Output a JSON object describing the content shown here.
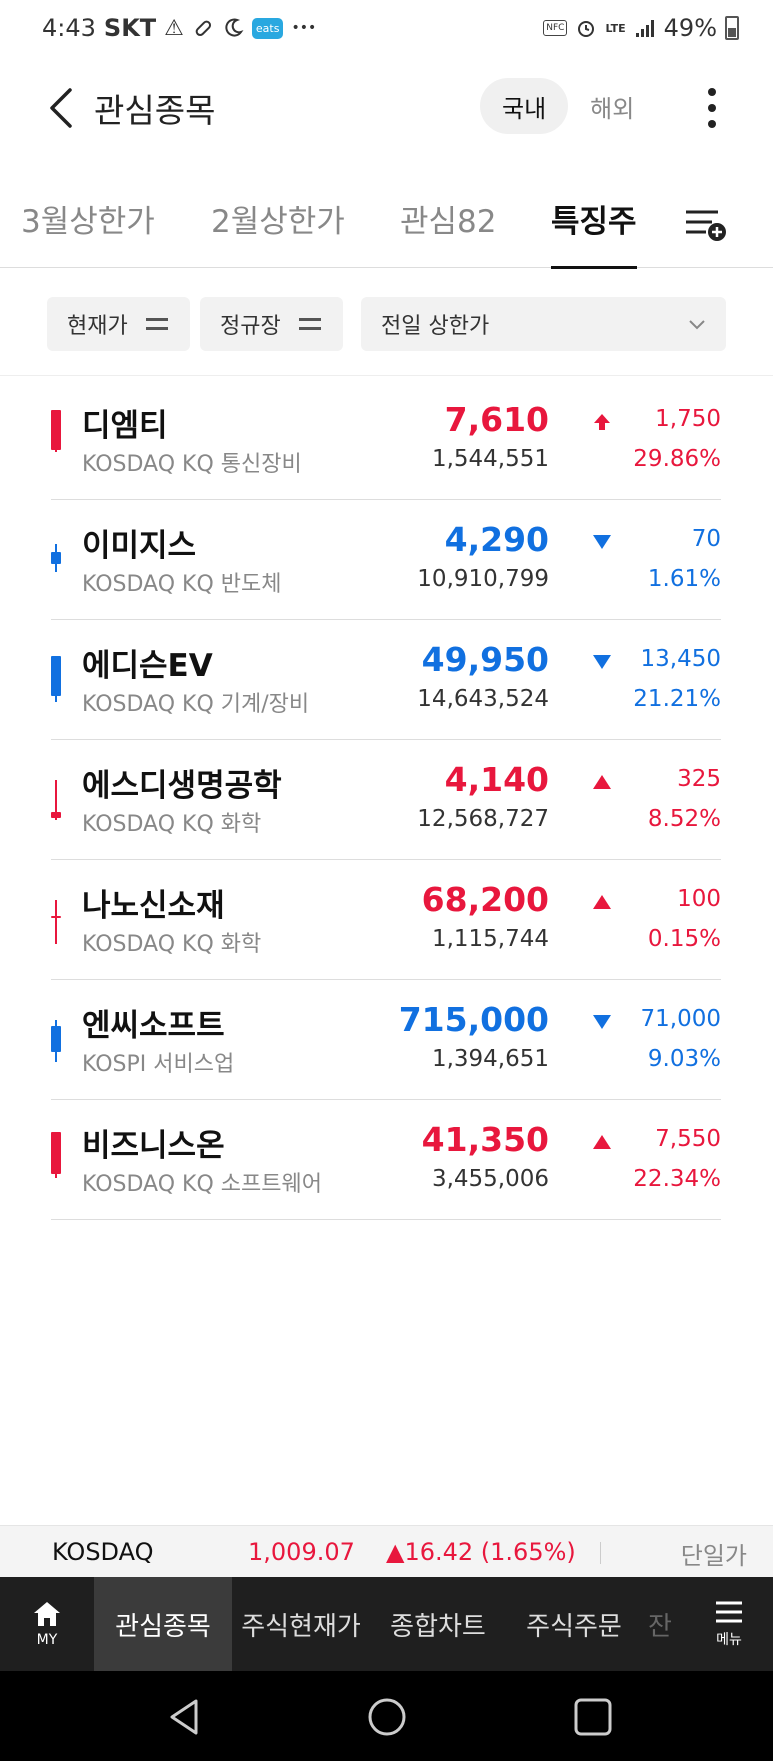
{
  "status_bar": {
    "time": "4:43",
    "carrier": "SKT",
    "eats_badge": "eats",
    "nfc_badge": "NFC",
    "network": "LTE",
    "battery": "49%",
    "icons": [
      "warning-icon",
      "pill-icon",
      "moon-icon",
      "alarm-icon",
      "signal-icon",
      "battery-icon"
    ]
  },
  "header": {
    "title": "관심종목",
    "toggle": {
      "domestic": "국내",
      "overseas": "해외",
      "selected": "국내"
    }
  },
  "tabs": {
    "items": [
      {
        "label": "3월상한가"
      },
      {
        "label": "2월상한가"
      },
      {
        "label": "관심82"
      },
      {
        "label": "특징주"
      }
    ],
    "selected": "특징주"
  },
  "filters": {
    "price": "현재가",
    "session": "정규장",
    "condition": "전일 상한가"
  },
  "colors": {
    "up": "#e8173d",
    "down": "#1170e0"
  },
  "stocks": [
    {
      "name": "디엠티",
      "market": "KOSDAQ KQ 통신장비",
      "price": "7,610",
      "volume": "1,544,551",
      "direction": "limit-up",
      "change": "1,750",
      "rate": "29.86%"
    },
    {
      "name": "이미지스",
      "market": "KOSDAQ KQ 반도체",
      "price": "4,290",
      "volume": "10,910,799",
      "direction": "down",
      "change": "70",
      "rate": "1.61%"
    },
    {
      "name": "에디슨EV",
      "market": "KOSDAQ KQ 기계/장비",
      "price": "49,950",
      "volume": "14,643,524",
      "direction": "down",
      "change": "13,450",
      "rate": "21.21%"
    },
    {
      "name": "에스디생명공학",
      "market": "KOSDAQ KQ 화학",
      "price": "4,140",
      "volume": "12,568,727",
      "direction": "up",
      "change": "325",
      "rate": "8.52%"
    },
    {
      "name": "나노신소재",
      "market": "KOSDAQ KQ 화학",
      "price": "68,200",
      "volume": "1,115,744",
      "direction": "up",
      "change": "100",
      "rate": "0.15%"
    },
    {
      "name": "엔씨소프트",
      "market": "KOSPI 서비스업",
      "price": "715,000",
      "volume": "1,394,651",
      "direction": "down",
      "change": "71,000",
      "rate": "9.03%"
    },
    {
      "name": "비즈니스온",
      "market": "KOSDAQ KQ 소프트웨어",
      "price": "41,350",
      "volume": "3,455,006",
      "direction": "up",
      "change": "7,550",
      "rate": "22.34%"
    }
  ],
  "ticker": {
    "name": "KOSDAQ",
    "value": "1,009.07",
    "change": "▲16.42 (1.65%)",
    "right_label": "단일가"
  },
  "bottom_nav": {
    "my": "MY",
    "items": [
      "관심종목",
      "주식현재가",
      "종합차트",
      "주식주문",
      "잔"
    ],
    "selected": "관심종목",
    "menu": "메뉴"
  }
}
